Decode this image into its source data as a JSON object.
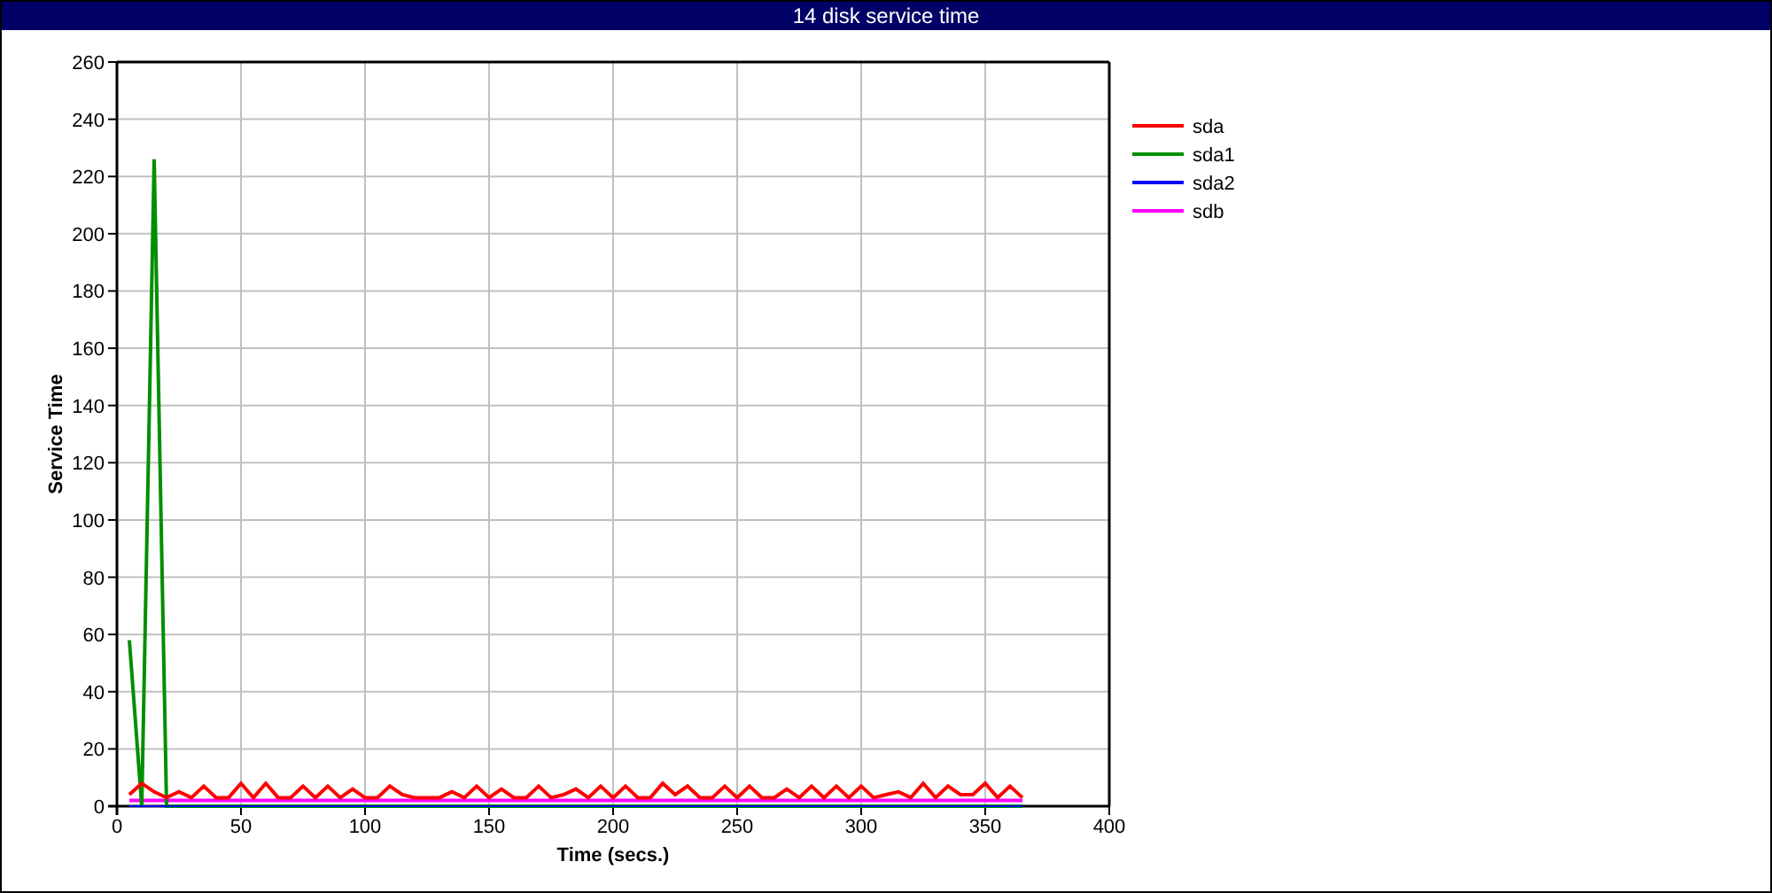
{
  "window": {
    "title": "14 disk service time"
  },
  "chart": {
    "chart_data": {
      "type": "line",
      "grid": true,
      "legend": "right",
      "xlabel": "Time (secs.)",
      "ylabel": "Service Time",
      "xlim": [
        0,
        400
      ],
      "ylim": [
        0,
        260
      ],
      "xticks": [
        0,
        50,
        100,
        150,
        200,
        250,
        300,
        350,
        400
      ],
      "yticks": [
        0,
        20,
        40,
        60,
        80,
        100,
        120,
        140,
        160,
        180,
        200,
        220,
        240,
        260
      ],
      "x": [
        5,
        10,
        15,
        20,
        25,
        30,
        35,
        40,
        45,
        50,
        55,
        60,
        65,
        70,
        75,
        80,
        85,
        90,
        95,
        100,
        105,
        110,
        115,
        120,
        125,
        130,
        135,
        140,
        145,
        150,
        155,
        160,
        165,
        170,
        175,
        180,
        185,
        190,
        195,
        200,
        205,
        210,
        215,
        220,
        225,
        230,
        235,
        240,
        245,
        250,
        255,
        260,
        265,
        270,
        275,
        280,
        285,
        290,
        295,
        300,
        305,
        310,
        315,
        320,
        325,
        330,
        335,
        340,
        345,
        350,
        355,
        360,
        365
      ],
      "series": [
        {
          "name": "sda",
          "color": "#ff0000",
          "values": [
            4,
            8,
            5,
            3,
            5,
            3,
            7,
            3,
            3,
            8,
            3,
            8,
            3,
            3,
            7,
            3,
            7,
            3,
            6,
            3,
            3,
            7,
            4,
            3,
            3,
            3,
            5,
            3,
            7,
            3,
            6,
            3,
            3,
            7,
            3,
            4,
            6,
            3,
            7,
            3,
            7,
            3,
            3,
            8,
            4,
            7,
            3,
            3,
            7,
            3,
            7,
            3,
            3,
            6,
            3,
            7,
            3,
            7,
            3,
            7,
            3,
            4,
            5,
            3,
            8,
            3,
            7,
            4,
            4,
            8,
            3,
            7,
            3
          ]
        },
        {
          "name": "sda1",
          "color": "#008f00",
          "values": [
            58,
            0,
            226,
            0,
            0,
            0,
            0,
            0,
            0,
            0,
            0,
            0,
            0,
            0,
            0,
            0,
            0,
            0,
            0,
            0,
            0,
            0,
            0,
            0,
            0,
            0,
            0,
            0,
            0,
            0,
            0,
            0,
            0,
            0,
            0,
            0,
            0,
            0,
            0,
            0,
            0,
            0,
            0,
            0,
            0,
            0,
            0,
            0,
            0,
            0,
            0,
            0,
            0,
            0,
            0,
            0,
            0,
            0,
            0,
            0,
            0,
            0,
            0,
            0,
            0,
            0,
            0,
            0,
            0,
            0,
            0,
            0,
            0
          ]
        },
        {
          "name": "sda2",
          "color": "#0000ff",
          "values": [
            0,
            0,
            0,
            0,
            0,
            0,
            0,
            0,
            0,
            0,
            0,
            0,
            0,
            0,
            0,
            0,
            0,
            0,
            0,
            0,
            0,
            0,
            0,
            0,
            0,
            0,
            0,
            0,
            0,
            0,
            0,
            0,
            0,
            0,
            0,
            0,
            0,
            0,
            0,
            0,
            0,
            0,
            0,
            0,
            0,
            0,
            0,
            0,
            0,
            0,
            0,
            0,
            0,
            0,
            0,
            0,
            0,
            0,
            0,
            0,
            0,
            0,
            0,
            0,
            0,
            0,
            0,
            0,
            0,
            0,
            0,
            0,
            0
          ]
        },
        {
          "name": "sdb",
          "color": "#ff00ff",
          "values": [
            2,
            2,
            2,
            2,
            2,
            2,
            2,
            2,
            2,
            2,
            2,
            2,
            2,
            2,
            2,
            2,
            2,
            2,
            2,
            2,
            2,
            2,
            2,
            2,
            2,
            2,
            2,
            2,
            2,
            2,
            2,
            2,
            2,
            2,
            2,
            2,
            2,
            2,
            2,
            2,
            2,
            2,
            2,
            2,
            2,
            2,
            2,
            2,
            2,
            2,
            2,
            2,
            2,
            2,
            2,
            2,
            2,
            2,
            2,
            2,
            2,
            2,
            2,
            2,
            2,
            2,
            2,
            2,
            2,
            2,
            2,
            2,
            2
          ]
        }
      ]
    }
  }
}
